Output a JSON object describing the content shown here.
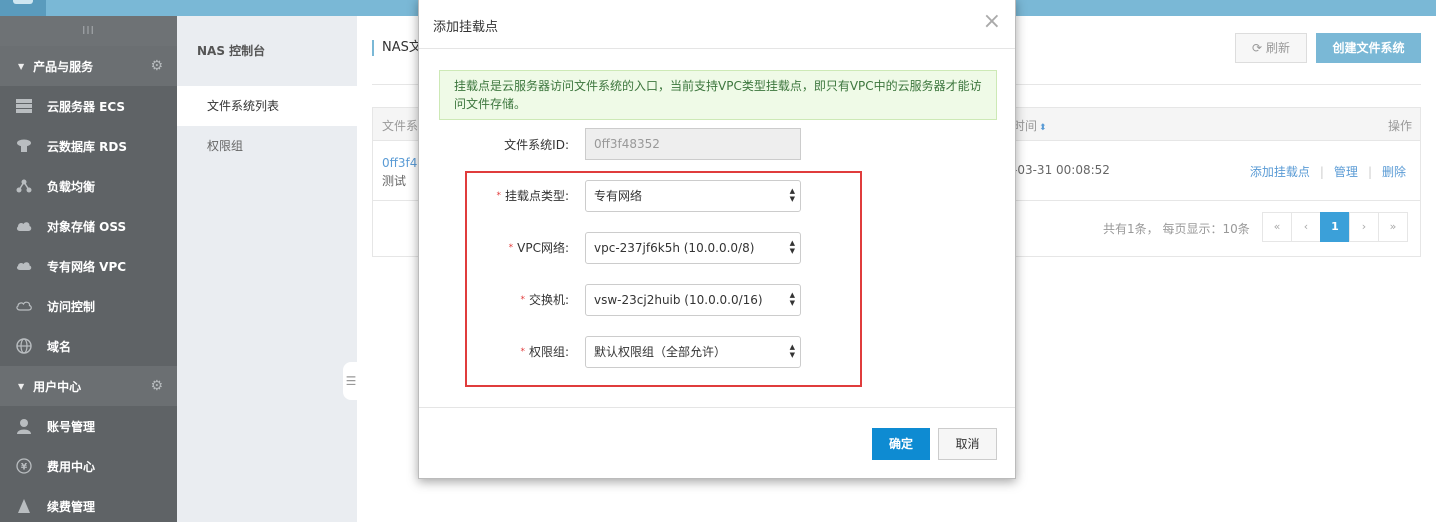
{
  "sidebar": {
    "toggle": "III",
    "sections": [
      {
        "label": "产品与服务",
        "items": [
          {
            "label": "云服务器 ECS",
            "icon": "server-icon"
          },
          {
            "label": "云数据库 RDS",
            "icon": "database-icon"
          },
          {
            "label": "负载均衡",
            "icon": "load-balancer-icon"
          },
          {
            "label": "对象存储 OSS",
            "icon": "cloud-storage-icon"
          },
          {
            "label": "专有网络 VPC",
            "icon": "vpc-icon"
          },
          {
            "label": "访问控制",
            "icon": "access-control-icon"
          },
          {
            "label": "域名",
            "icon": "globe-icon"
          }
        ]
      },
      {
        "label": "用户中心",
        "items": [
          {
            "label": "账号管理",
            "icon": "user-icon"
          },
          {
            "label": "费用中心",
            "icon": "yen-icon"
          },
          {
            "label": "续费管理",
            "icon": "renew-icon"
          }
        ]
      }
    ]
  },
  "subnav": {
    "title": "NAS 控制台",
    "items": [
      "文件系统列表",
      "权限组"
    ]
  },
  "main": {
    "breadcrumb": "NAS文",
    "refresh_label": "刷新",
    "create_label": "创建文件系统",
    "table": {
      "col_name": "文件系",
      "col_time": "时间",
      "col_ops": "操作",
      "row": {
        "id": "0ff3f48",
        "desc": "测试",
        "time": "-03-31 00:08:52",
        "op_add": "添加挂载点",
        "op_manage": "管理",
        "op_delete": "删除"
      },
      "summary": "共有1条， 每页显示：10条",
      "pager": {
        "first": "«",
        "prev": "‹",
        "current": "1",
        "next": "›",
        "last": "»"
      }
    }
  },
  "modal": {
    "title": "添加挂载点",
    "close": "×",
    "notice": "挂载点是云服务器访问文件系统的入口，当前支持VPC类型挂载点，即只有VPC中的云服务器才能访问文件存储。",
    "fs_id_label": "文件系统ID:",
    "fs_id_value": "0ff3f48352",
    "mount_type_label": "挂载点类型:",
    "mount_type_value": "专有网络",
    "vpc_label": "VPC网络:",
    "vpc_value": "vpc-237jf6k5h (10.0.0.0/8)",
    "vswitch_label": "交换机:",
    "vswitch_value": "vsw-23cj2huib (10.0.0.0/16)",
    "perm_group_label": "权限组:",
    "perm_group_value": "默认权限组（全部允许）",
    "required_mark": "*",
    "ok_label": "确定",
    "cancel_label": "取消"
  },
  "colors": {
    "accent": "#7ab8d6",
    "primary_button": "#0e8bd2",
    "highlight_border": "#e03c3c",
    "sidebar_bg": "#5f6366"
  }
}
